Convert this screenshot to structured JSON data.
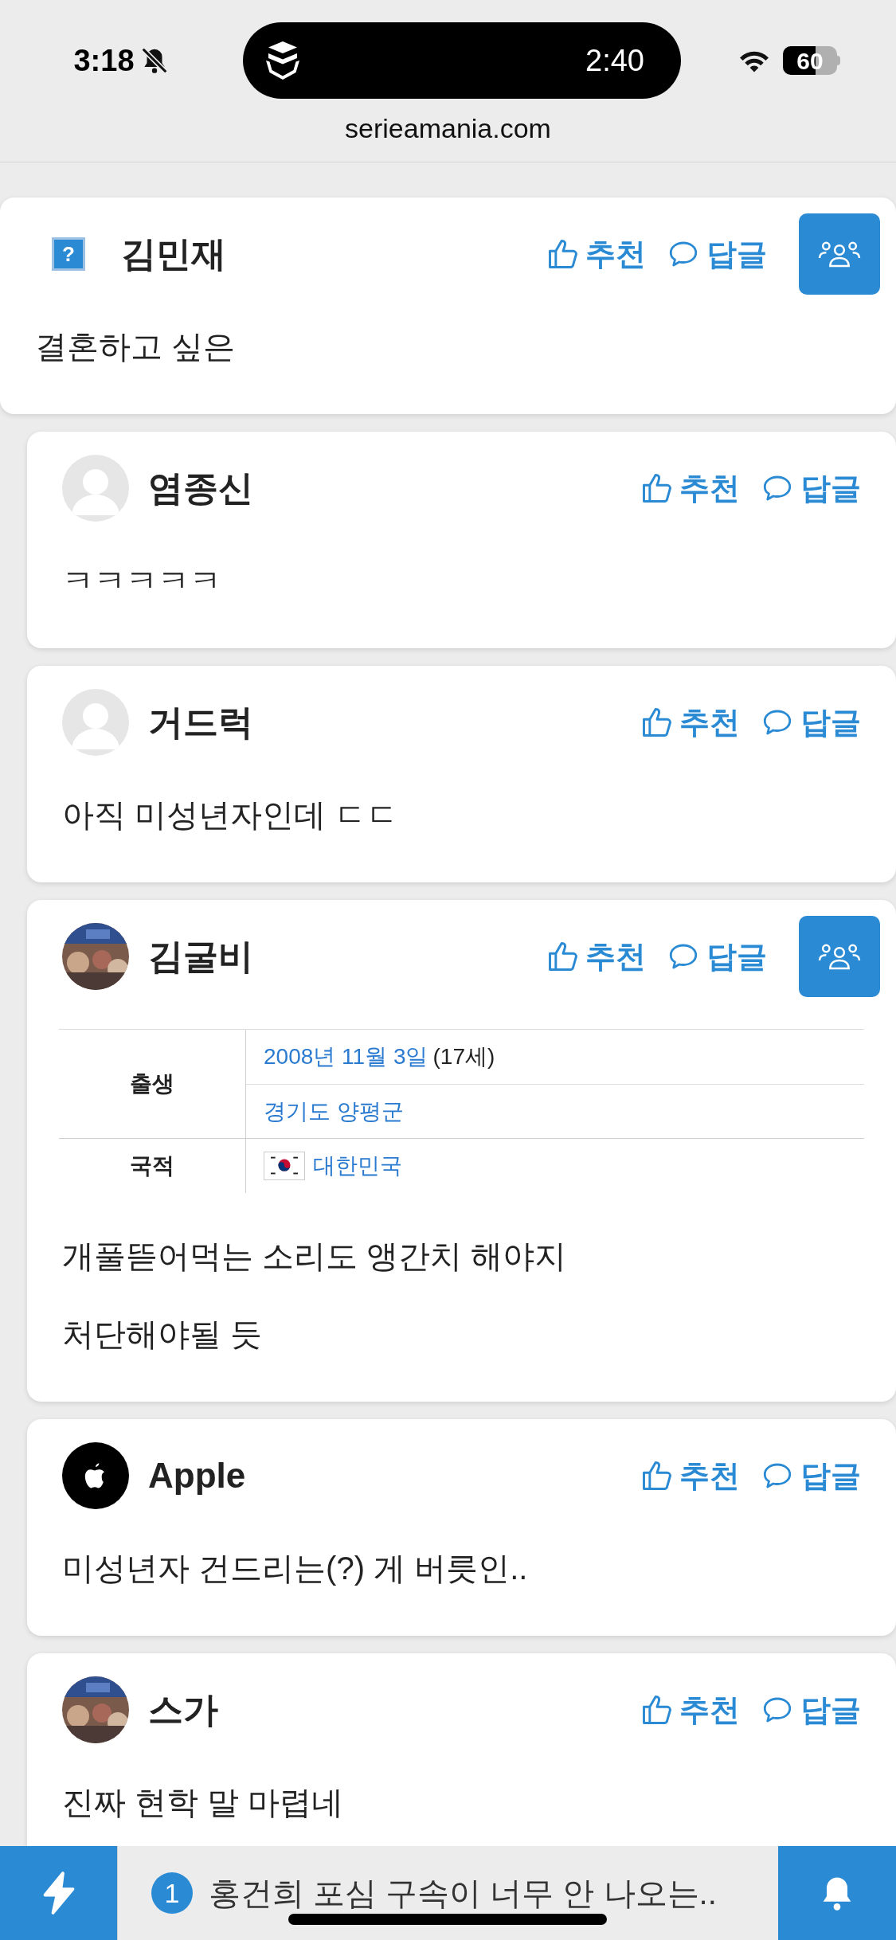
{
  "status_bar": {
    "time": "3:18",
    "muted": true,
    "island_time": "2:40",
    "battery": "60"
  },
  "address": "serieamania.com",
  "comments": [
    {
      "author": "김민재",
      "avatar": {
        "kind": "placeholder",
        "glyph": "?"
      },
      "reply": false,
      "recommend": "추천",
      "answer": "답글",
      "group_button": true,
      "lines": [
        "결혼하고 싶은"
      ]
    },
    {
      "author": "염종신",
      "avatar": {
        "kind": "default"
      },
      "reply": true,
      "recommend": "추천",
      "answer": "답글",
      "group_button": false,
      "lines": [
        "ㅋㅋㅋㅋㅋ"
      ]
    },
    {
      "author": "거드럭",
      "avatar": {
        "kind": "default"
      },
      "reply": true,
      "recommend": "추천",
      "answer": "답글",
      "group_button": false,
      "lines": [
        "아직 미성년자인데 ㄷㄷ"
      ]
    },
    {
      "author": "김굴비",
      "avatar": {
        "kind": "picture"
      },
      "reply": true,
      "recommend": "추천",
      "answer": "답글",
      "group_button": true,
      "infobox": {
        "rows": [
          {
            "label": "출생",
            "cells": [
              {
                "link": "2008년 11월 3일",
                "plain": "(17세)"
              },
              {
                "link": "경기도 양평군"
              }
            ]
          },
          {
            "label": "국적",
            "cells": [
              {
                "flag": true,
                "link": "대한민국"
              }
            ]
          }
        ]
      },
      "lines": [
        "개풀뜯어먹는 소리도 앵간치 해야지",
        "처단해야될 듯"
      ]
    },
    {
      "author": "Apple",
      "avatar": {
        "kind": "apple"
      },
      "reply": true,
      "recommend": "추천",
      "answer": "답글",
      "group_button": false,
      "lines": [
        "미성년자 건드리는(?) 게 버릇인.."
      ]
    },
    {
      "author": "스가",
      "avatar": {
        "kind": "picture"
      },
      "reply": true,
      "recommend": "추천",
      "answer": "답글",
      "group_button": false,
      "lines": [
        "진짜 현학 말 마렵네"
      ]
    }
  ],
  "bottom_bar": {
    "count": "1",
    "headline": "홍건희 포심 구속이 너무 안 나오는.."
  }
}
